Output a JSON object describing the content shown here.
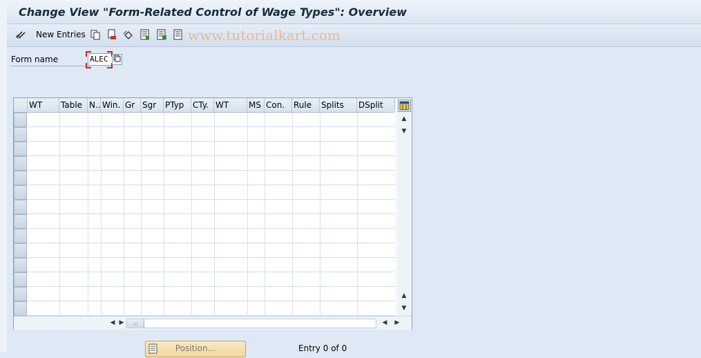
{
  "window": {
    "title": "Change View \"Form-Related Control of Wage Types\": Overview"
  },
  "toolbar": {
    "new_entries_label": "New Entries",
    "icons": [
      "edit-glasses-icon",
      "copy-icon",
      "delete-icon",
      "undo-icon",
      "select-all-icon",
      "select-block-icon",
      "deselect-all-icon"
    ],
    "watermark": "www.tutorialkart.com"
  },
  "form": {
    "label": "Form name",
    "value": "ALEC"
  },
  "table": {
    "columns": [
      "WT",
      "Table",
      "N..",
      "Win.",
      "Gr",
      "Sgr",
      "PTyp",
      "CTy.",
      "WT",
      "MS",
      "Con.",
      "Rule",
      "Splits",
      "DSplit"
    ],
    "row_count": 14,
    "rows": []
  },
  "footer": {
    "position_label": "Position...",
    "entry_text": "Entry 0 of 0"
  },
  "colors": {
    "background": "#dfe9f5",
    "button_accent": "#f2d79e",
    "focus_bracket": "#cc2222"
  }
}
